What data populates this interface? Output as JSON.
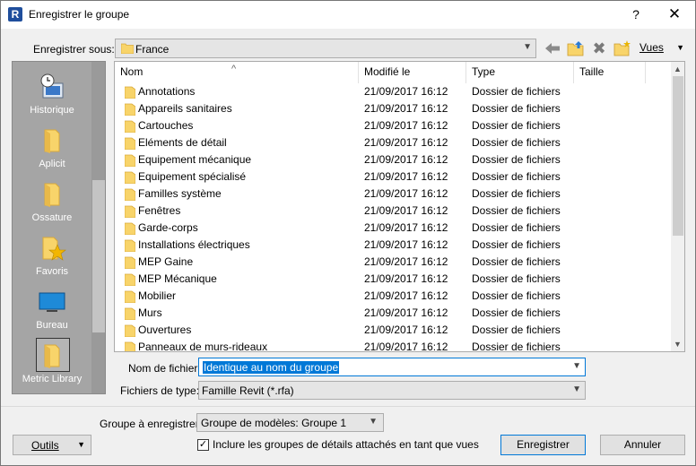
{
  "window": {
    "title": "Enregistrer le groupe",
    "app_icon_letter": "R",
    "help": "?",
    "close": "✕"
  },
  "toolbar": {
    "save_in_label": "Enregistrer sous:",
    "save_in_value": "France",
    "views_label": "Vues"
  },
  "places": [
    {
      "label": "Historique",
      "icon": "history-icon"
    },
    {
      "label": "Aplicit",
      "icon": "folder-icon"
    },
    {
      "label": "Ossature",
      "icon": "folder-icon"
    },
    {
      "label": "Favoris",
      "icon": "favorites-icon"
    },
    {
      "label": "Bureau",
      "icon": "desktop-icon"
    },
    {
      "label": "Metric Library",
      "icon": "folder-icon",
      "selected": true
    }
  ],
  "columns": {
    "name": "Nom",
    "modified": "Modifié le",
    "type": "Type",
    "size": "Taille"
  },
  "files": [
    {
      "name": "Annotations",
      "date": "21/09/2017 16:12",
      "type": "Dossier de fichiers"
    },
    {
      "name": "Appareils sanitaires",
      "date": "21/09/2017 16:12",
      "type": "Dossier de fichiers"
    },
    {
      "name": "Cartouches",
      "date": "21/09/2017 16:12",
      "type": "Dossier de fichiers"
    },
    {
      "name": "Eléments de détail",
      "date": "21/09/2017 16:12",
      "type": "Dossier de fichiers"
    },
    {
      "name": "Equipement mécanique",
      "date": "21/09/2017 16:12",
      "type": "Dossier de fichiers"
    },
    {
      "name": "Equipement spécialisé",
      "date": "21/09/2017 16:12",
      "type": "Dossier de fichiers"
    },
    {
      "name": "Familles système",
      "date": "21/09/2017 16:12",
      "type": "Dossier de fichiers"
    },
    {
      "name": "Fenêtres",
      "date": "21/09/2017 16:12",
      "type": "Dossier de fichiers"
    },
    {
      "name": "Garde-corps",
      "date": "21/09/2017 16:12",
      "type": "Dossier de fichiers"
    },
    {
      "name": "Installations électriques",
      "date": "21/09/2017 16:12",
      "type": "Dossier de fichiers"
    },
    {
      "name": "MEP Gaine",
      "date": "21/09/2017 16:12",
      "type": "Dossier de fichiers"
    },
    {
      "name": "MEP Mécanique",
      "date": "21/09/2017 16:12",
      "type": "Dossier de fichiers"
    },
    {
      "name": "Mobilier",
      "date": "21/09/2017 16:12",
      "type": "Dossier de fichiers"
    },
    {
      "name": "Murs",
      "date": "21/09/2017 16:12",
      "type": "Dossier de fichiers"
    },
    {
      "name": "Ouvertures",
      "date": "21/09/2017 16:12",
      "type": "Dossier de fichiers"
    },
    {
      "name": "Panneaux de murs-rideaux",
      "date": "21/09/2017 16:12",
      "type": "Dossier de fichiers"
    }
  ],
  "filename": {
    "label": "Nom de fichier:",
    "value": "Identique au nom du groupe"
  },
  "filetype": {
    "label": "Fichiers de type:",
    "value": "Famille Revit  (*.rfa)"
  },
  "group": {
    "label": "Groupe à enregistrer:",
    "value": "Groupe de modèles: Groupe 1"
  },
  "tools_label": "Outils",
  "include_checkbox": {
    "label": "Inclure les groupes de détails attachés en tant que vues",
    "checked": true,
    "mark": "✓"
  },
  "buttons": {
    "save": "Enregistrer",
    "cancel": "Annuler"
  },
  "colors": {
    "accent": "#0078d7",
    "folder": "#f8d46a"
  }
}
